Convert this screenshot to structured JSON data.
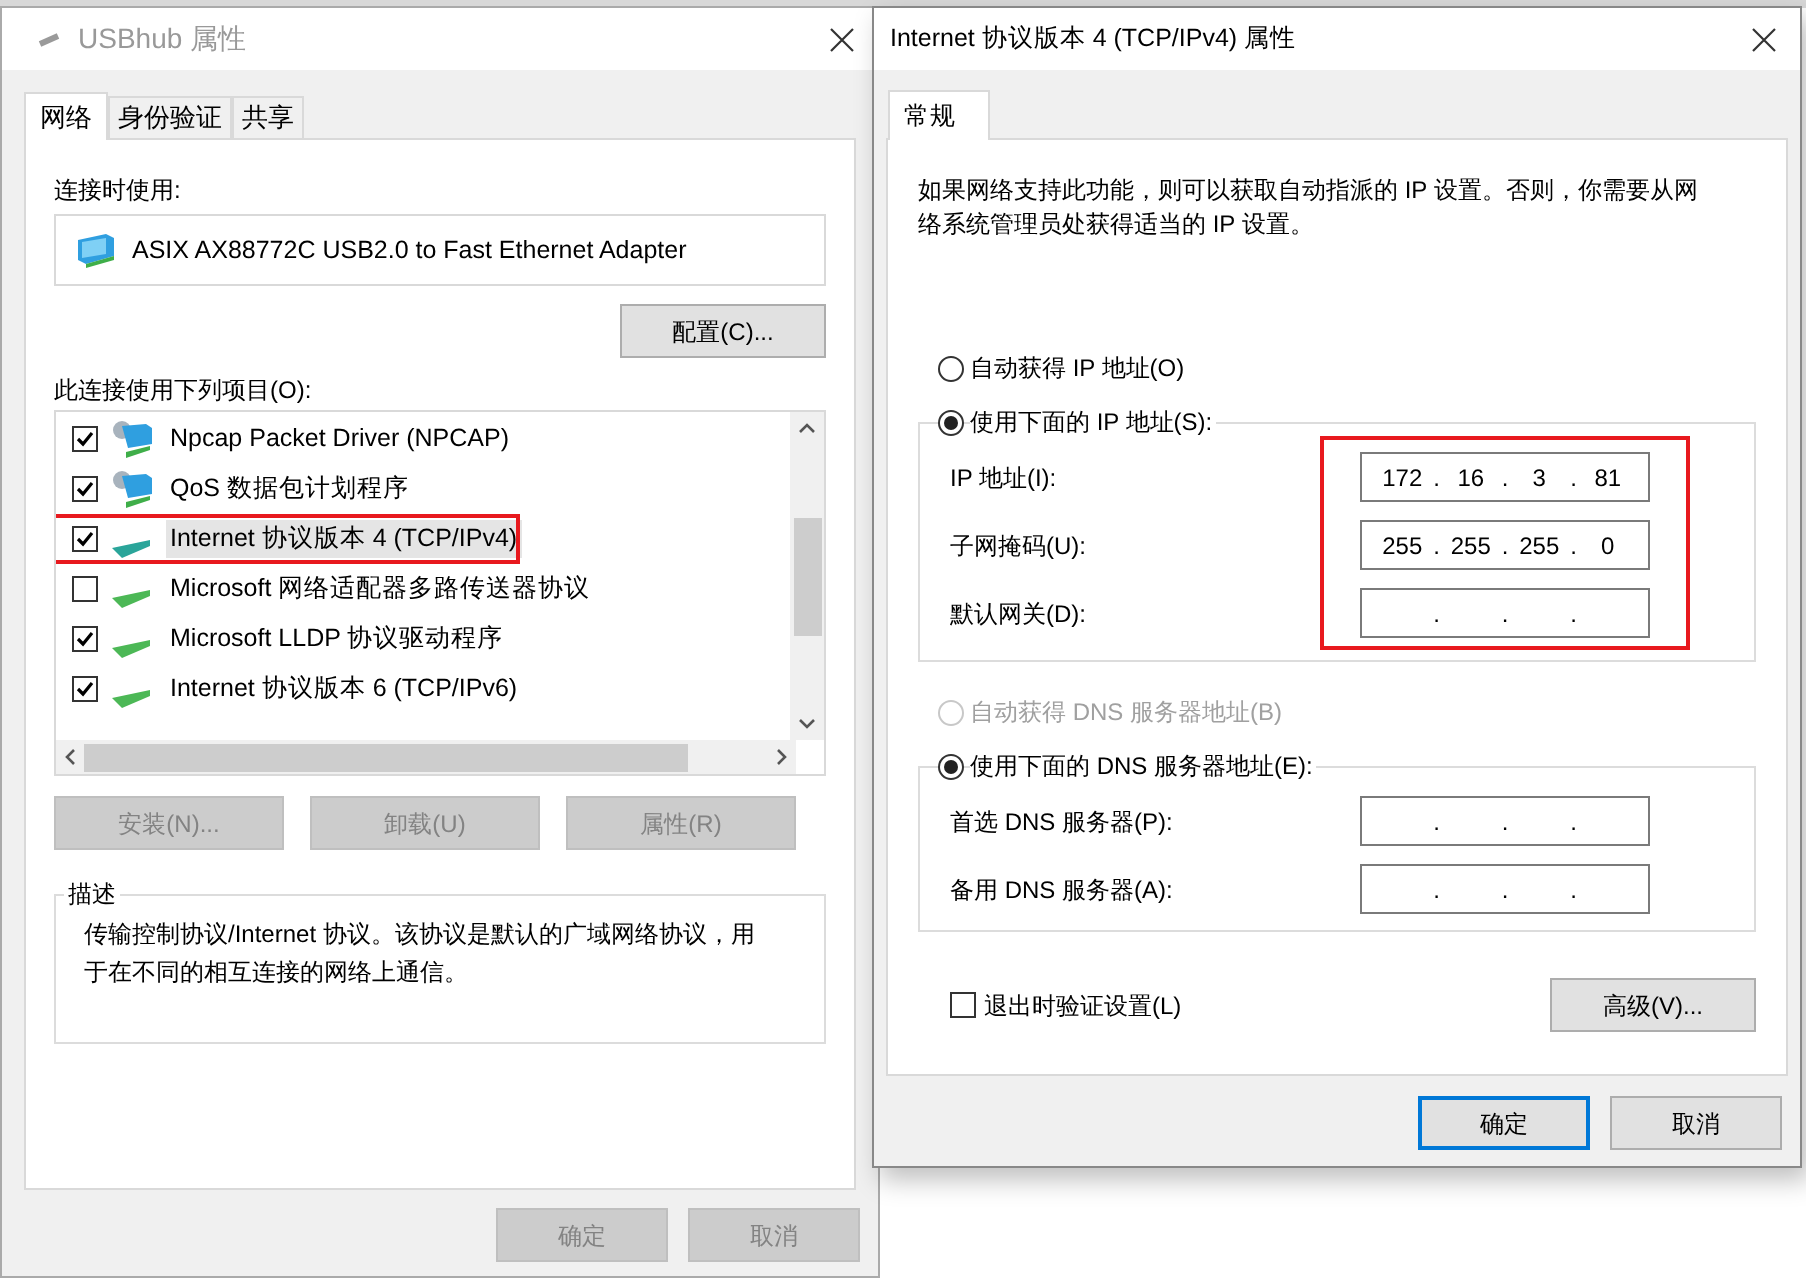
{
  "usbhub_window": {
    "title": "USBhub 属性",
    "tabs": [
      {
        "label": "网络",
        "selected": true
      },
      {
        "label": "身份验证",
        "selected": false
      },
      {
        "label": "共享",
        "selected": false
      }
    ],
    "connect_using_label": "连接时使用:",
    "adapter_name": "ASIX AX88772C USB2.0 to Fast Ethernet Adapter",
    "configure_button": "配置(C)...",
    "items_label": "此连接使用下列项目(O):",
    "items": [
      {
        "kind": "service",
        "label": "Npcap Packet Driver (NPCAP)",
        "checked": true,
        "selected": false,
        "highlighted": false
      },
      {
        "kind": "service",
        "label": "QoS 数据包计划程序",
        "checked": true,
        "selected": false,
        "highlighted": false
      },
      {
        "kind": "protocol",
        "label": "Internet 协议版本 4 (TCP/IPv4)",
        "checked": true,
        "selected": true,
        "highlighted": true
      },
      {
        "kind": "protocol",
        "label": "Microsoft 网络适配器多路传送器协议",
        "checked": false,
        "selected": false,
        "highlighted": false
      },
      {
        "kind": "protocol",
        "label": "Microsoft LLDP 协议驱动程序",
        "checked": true,
        "selected": false,
        "highlighted": false
      },
      {
        "kind": "protocol",
        "label": "Internet 协议版本 6 (TCP/IPv6)",
        "checked": true,
        "selected": false,
        "highlighted": false
      }
    ],
    "item_buttons": [
      {
        "label": "安装(N)...",
        "disabled": true
      },
      {
        "label": "卸载(U)",
        "disabled": true
      },
      {
        "label": "属性(R)",
        "disabled": true
      }
    ],
    "description_label": "描述",
    "description": "传输控制协议/Internet 协议。该协议是默认的广域网络协议，用于在不同的相互连接的网络上通信。",
    "footer_buttons": [
      {
        "label": "确定",
        "disabled": true
      },
      {
        "label": "取消",
        "disabled": true
      }
    ]
  },
  "ipv4_dialog": {
    "title": "Internet 协议版本 4 (TCP/IPv4) 属性",
    "tabs": [
      {
        "label": "常规",
        "selected": true
      }
    ],
    "intro": "如果网络支持此功能，则可以获取自动指派的 IP 设置。否则，你需要从网络系统管理员处获得适当的 IP 设置。",
    "ip_options": [
      {
        "label": "自动获得 IP 地址(O)",
        "selected": false,
        "disabled": false
      },
      {
        "label": "使用下面的 IP 地址(S):",
        "selected": true,
        "disabled": false
      }
    ],
    "ip_fields_highlighted": true,
    "ip_fields": [
      {
        "label": "IP 地址(I):",
        "octets": [
          "172",
          "16",
          "3",
          "81"
        ],
        "separators": [
          ".",
          ".",
          "."
        ]
      },
      {
        "label": "子网掩码(U):",
        "octets": [
          "255",
          "255",
          "255",
          "0"
        ],
        "separators": [
          ".",
          ".",
          "."
        ]
      },
      {
        "label": "默认网关(D):",
        "separators": [
          ".",
          ".",
          "."
        ]
      }
    ],
    "dns_options": [
      {
        "label": "自动获得 DNS 服务器地址(B)",
        "selected": false,
        "disabled": true
      },
      {
        "label": "使用下面的 DNS 服务器地址(E):",
        "selected": true,
        "disabled": false
      }
    ],
    "dns_fields": [
      {
        "label": "首选 DNS 服务器(P):",
        "separators": [
          ".",
          ".",
          "."
        ]
      },
      {
        "label": "备用 DNS 服务器(A):",
        "separators": [
          ".",
          ".",
          "."
        ]
      }
    ],
    "validate_checkbox": {
      "label": "退出时验证设置(L)",
      "checked": false
    },
    "advanced_button": "高级(V)...",
    "footer_buttons": [
      {
        "label": "确定",
        "disabled": false,
        "default": true
      },
      {
        "label": "取消",
        "disabled": false,
        "default": false
      }
    ]
  }
}
